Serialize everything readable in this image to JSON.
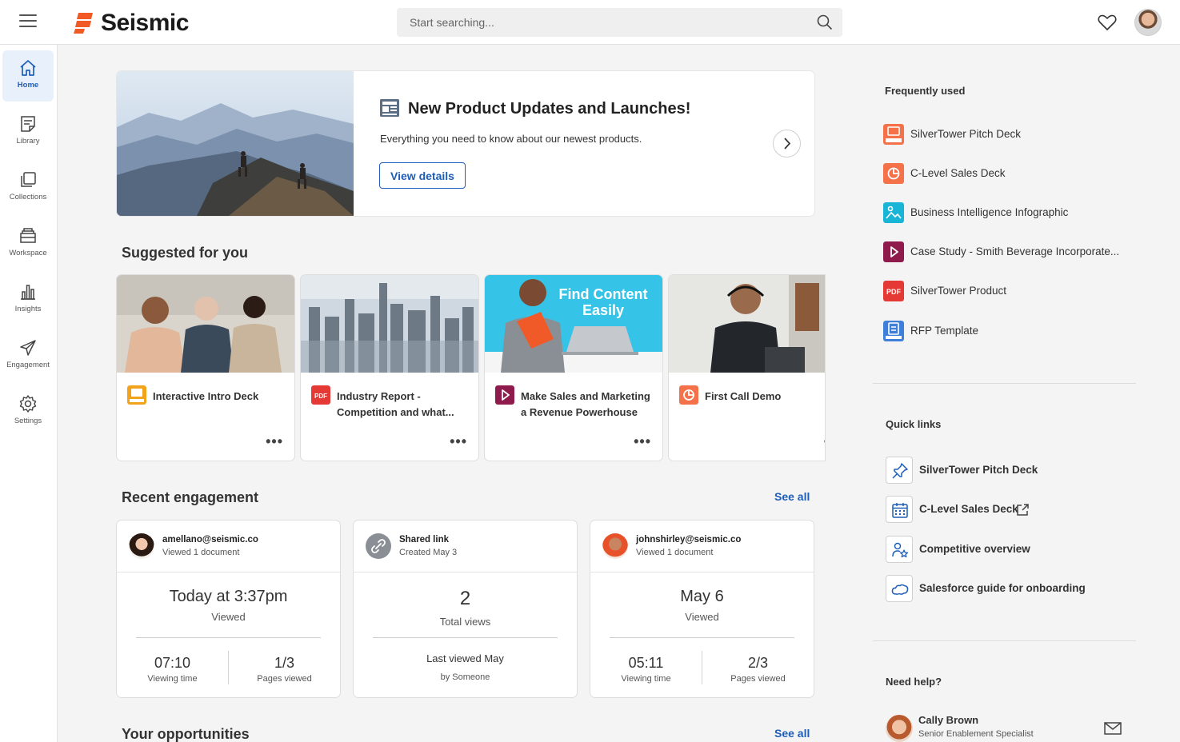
{
  "app": {
    "brand": "Seismic",
    "brand_color": "#f15a24",
    "accent": "#1e5eb8"
  },
  "search": {
    "placeholder": "Start searching..."
  },
  "sidebar": {
    "items": [
      {
        "label": "Home",
        "icon": "home-icon",
        "active": true
      },
      {
        "label": "Library",
        "icon": "library-icon"
      },
      {
        "label": "Collections",
        "icon": "collections-icon"
      },
      {
        "label": "Workspace",
        "icon": "workspace-icon"
      },
      {
        "label": "Insights",
        "icon": "insights-icon"
      },
      {
        "label": "Engagement",
        "icon": "engagement-icon"
      },
      {
        "label": "Settings",
        "icon": "gear-icon"
      }
    ]
  },
  "hero": {
    "title": "New Product Updates and Launches!",
    "subtitle": "Everything you need to know about our newest products.",
    "button": "View details"
  },
  "suggested": {
    "title": "Suggested for you",
    "cards": [
      {
        "title": "Interactive Intro Deck",
        "type": "livedoc"
      },
      {
        "title": "Industry Report - Competition and what...",
        "type": "pdf"
      },
      {
        "title": "Make Sales and Marketing a Revenue Powerhouse",
        "type": "video",
        "thumb_text": "Find Content Easily"
      },
      {
        "title": "First Call Demo",
        "type": "pptx"
      }
    ]
  },
  "engagement": {
    "title": "Recent engagement",
    "see_all": "See all",
    "cards": [
      {
        "name": "amellano@seismic.co",
        "meta": "Viewed 1 document",
        "big": "Today at 3:37pm",
        "big_label": "Viewed",
        "left_value": "07:10",
        "left_label": "Viewing time",
        "right_value": "1/3",
        "right_label": "Pages viewed"
      },
      {
        "name": "Shared link",
        "meta": "Created May 3",
        "big": "2",
        "big_label": "Total views",
        "footer_1": "Last viewed May",
        "footer_2": "by Someone"
      },
      {
        "name": "johnshirley@seismic.co",
        "meta": "Viewed 1 document",
        "big": "May 6",
        "big_label": "Viewed",
        "left_value": "05:11",
        "left_label": "Viewing time",
        "right_value": "2/3",
        "right_label": "Pages viewed"
      }
    ]
  },
  "opportunities": {
    "title": "Your opportunities",
    "see_all": "See all"
  },
  "frequently_used": {
    "title": "Frequently used",
    "items": [
      {
        "label": "SilverTower Pitch Deck",
        "type": "livedoc"
      },
      {
        "label": "C-Level Sales Deck",
        "type": "pptx"
      },
      {
        "label": "Business Intelligence Infographic",
        "type": "image"
      },
      {
        "label": "Case Study - Smith Beverage Incorporate...",
        "type": "video"
      },
      {
        "label": "SilverTower Product",
        "type": "pdf"
      },
      {
        "label": "RFP Template",
        "type": "livedoc"
      }
    ]
  },
  "quick_links": {
    "title": "Quick links",
    "items": [
      {
        "label": "SilverTower Pitch Deck",
        "icon": "pin-icon"
      },
      {
        "label": "C-Level Sales Deck",
        "icon": "calendar-icon"
      },
      {
        "label": "Competitive overview",
        "icon": "user-star-icon"
      },
      {
        "label": "Salesforce guide for onboarding",
        "icon": "salesforce-cloud-icon"
      }
    ]
  },
  "help": {
    "title": "Need help?",
    "name": "Cally Brown",
    "role": "Senior Enablement Specialist"
  }
}
